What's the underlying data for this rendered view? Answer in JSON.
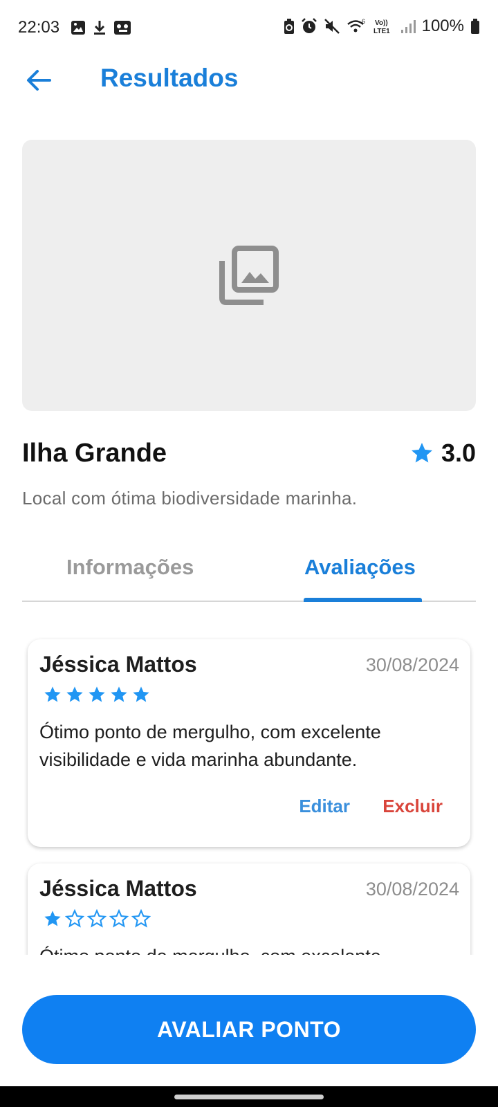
{
  "status_bar": {
    "time": "22:03",
    "battery": "100%",
    "left_icons": [
      "gallery-icon",
      "download-icon",
      "voicemail-icon"
    ],
    "right_icons": [
      "battery-saver-icon",
      "alarm-icon",
      "mute-icon",
      "wifi-6-icon",
      "volte-icon",
      "signal-icon",
      "battery-icon"
    ]
  },
  "app_bar": {
    "title": "Resultados",
    "back_icon": "arrow-left-icon"
  },
  "place": {
    "image_icon": "photo-library-icon",
    "name": "Ilha Grande",
    "rating": "3.0",
    "description": "Local com ótima biodiversidade marinha."
  },
  "tabs": [
    {
      "label": "Informações",
      "active": false
    },
    {
      "label": "Avaliações",
      "active": true
    }
  ],
  "reviews": [
    {
      "author": "Jéssica Mattos",
      "date": "30/08/2024",
      "stars": 5,
      "text": "Ótimo ponto de mergulho, com excelente visibilidade e vida marinha abundante.",
      "edit_label": "Editar",
      "delete_label": "Excluir"
    },
    {
      "author": "Jéssica Mattos",
      "date": "30/08/2024",
      "stars": 1,
      "text": "Ótimo ponto de mergulho, com excelente visibilidade e vida marinha abundante."
    }
  ],
  "cta": {
    "label": "AVALIAR PONTO"
  },
  "colors": {
    "primary": "#1a7fd9",
    "cta": "#0f80f2",
    "star": "#2196f3",
    "delete": "#d9453b",
    "image_placeholder": "#eeeeee"
  }
}
